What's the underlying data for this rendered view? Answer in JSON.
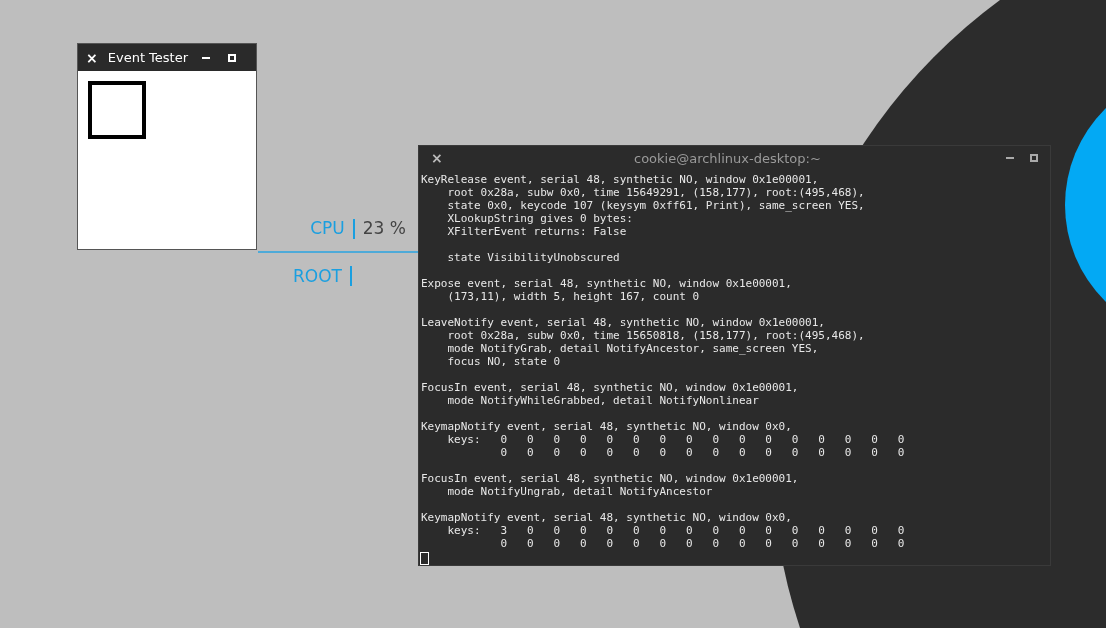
{
  "event_tester": {
    "title": "Event Tester",
    "close": "×"
  },
  "conky": {
    "rows": [
      {
        "label": "CPU",
        "value": "23 %"
      },
      {
        "label": "ROOT",
        "value": ""
      }
    ]
  },
  "terminal": {
    "title": "cookie@archlinux-desktop:~",
    "close": "×",
    "blocks": [
      [
        "KeyRelease event, serial 48, synthetic NO, window 0x1e00001,",
        "    root 0x28a, subw 0x0, time 15649291, (158,177), root:(495,468),",
        "    state 0x0, keycode 107 (keysym 0xff61, Print), same_screen YES,",
        "    XLookupString gives 0 bytes:",
        "    XFilterEvent returns: False"
      ],
      [
        "    state VisibilityUnobscured"
      ],
      [
        "Expose event, serial 48, synthetic NO, window 0x1e00001,",
        "    (173,11), width 5, height 167, count 0"
      ],
      [
        "LeaveNotify event, serial 48, synthetic NO, window 0x1e00001,",
        "    root 0x28a, subw 0x0, time 15650818, (158,177), root:(495,468),",
        "    mode NotifyGrab, detail NotifyAncestor, same_screen YES,",
        "    focus NO, state 0"
      ],
      [
        "FocusIn event, serial 48, synthetic NO, window 0x1e00001,",
        "    mode NotifyWhileGrabbed, detail NotifyNonlinear"
      ],
      [
        "KeymapNotify event, serial 48, synthetic NO, window 0x0,",
        "    keys:   0   0   0   0   0   0   0   0   0   0   0   0   0   0   0   0",
        "            0   0   0   0   0   0   0   0   0   0   0   0   0   0   0   0"
      ],
      [
        "FocusIn event, serial 48, synthetic NO, window 0x1e00001,",
        "    mode NotifyUngrab, detail NotifyAncestor"
      ],
      [
        "KeymapNotify event, serial 48, synthetic NO, window 0x0,",
        "    keys:   3   0   0   0   0   0   0   0   0   0   0   0   0   0   0   0",
        "            0   0   0   0   0   0   0   0   0   0   0   0   0   0   0   0"
      ]
    ]
  }
}
